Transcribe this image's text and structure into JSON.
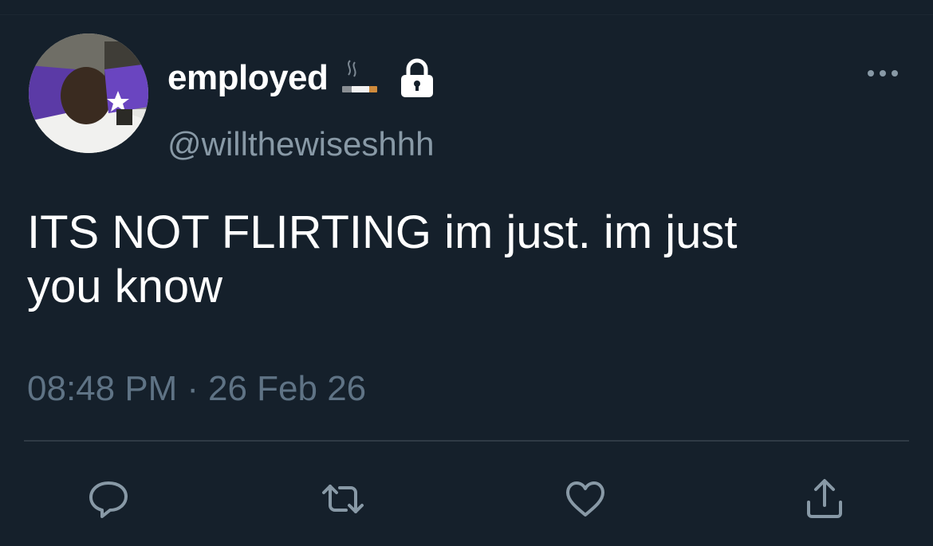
{
  "tweet": {
    "display_name": "employed",
    "name_emoji": "cigarette-icon",
    "protected_icon": "lock-icon",
    "handle": "@willthewiseshhh",
    "text_lines": [
      "ITS NOT FLIRTING im just. im just",
      "you know"
    ],
    "time": "08:48 PM",
    "separator": "·",
    "date": "26 Feb 26"
  },
  "actions": [
    {
      "icon": "reply-icon"
    },
    {
      "icon": "retweet-icon"
    },
    {
      "icon": "like-icon"
    },
    {
      "icon": "share-icon"
    }
  ],
  "colors": {
    "background": "#15202b",
    "primary_text": "#ffffff",
    "secondary_text": "#8899a6",
    "timestamp_text": "#5f7385",
    "divider": "#2f3a45"
  }
}
